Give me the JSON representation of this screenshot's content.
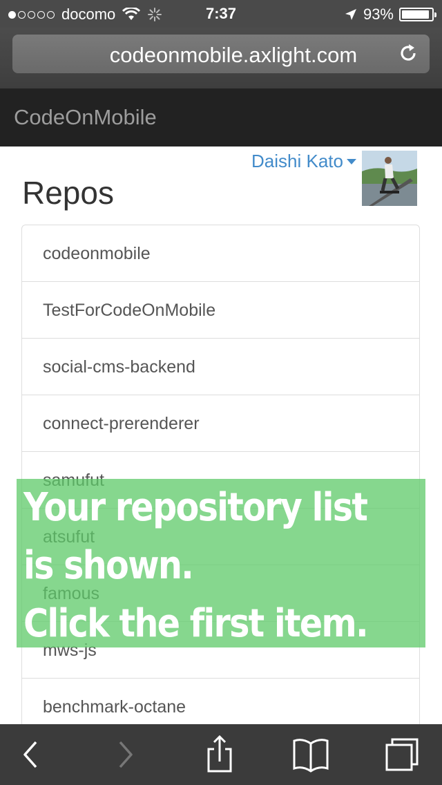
{
  "status_bar": {
    "carrier": "docomo",
    "signal_bars": 1,
    "time": "7:37",
    "battery_percent_text": "93%",
    "battery_level": 0.93
  },
  "browser": {
    "url": "codeonmobile.axlight.com"
  },
  "app": {
    "brand": "CodeOnMobile",
    "user_name": "Daishi Kato"
  },
  "page": {
    "title": "Repos",
    "repos": [
      "codeonmobile",
      "TestForCodeOnMobile",
      "social-cms-backend",
      "connect-prerenderer",
      "samufut",
      "atsufut",
      "famous",
      "mws-js",
      "benchmark-octane"
    ]
  },
  "overlay": {
    "line1": "Your repository list",
    "line2": "is shown.",
    "line3": "Click the first item."
  }
}
